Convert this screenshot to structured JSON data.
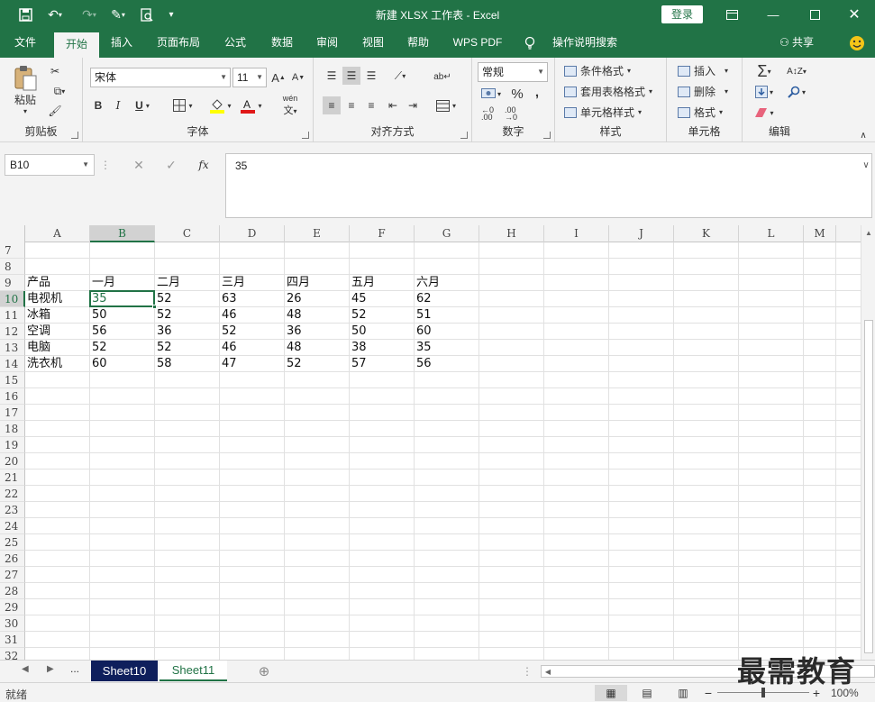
{
  "titlebar": {
    "title": "新建 XLSX 工作表  -  Excel",
    "login": "登录"
  },
  "menu": {
    "tabs": [
      "文件",
      "开始",
      "插入",
      "页面布局",
      "公式",
      "数据",
      "审阅",
      "视图",
      "帮助",
      "WPS PDF",
      "操作说明搜索"
    ],
    "share": "共享"
  },
  "ribbon": {
    "clipboard": {
      "label": "剪贴板",
      "paste": "粘贴"
    },
    "font": {
      "label": "字体",
      "name": "宋体",
      "size": "11",
      "bold": "B",
      "italic": "I",
      "underline": "U",
      "grow": "A",
      "shrink": "A",
      "phonetic": "wén"
    },
    "alignment": {
      "label": "对齐方式"
    },
    "number": {
      "label": "数字",
      "format": "常规",
      "percent": "%",
      "comma": ","
    },
    "styles": {
      "label": "样式",
      "conditional": "条件格式",
      "table": "套用表格格式",
      "cell": "单元格样式"
    },
    "cells": {
      "label": "单元格",
      "insert": "插入",
      "delete": "删除",
      "format": "格式"
    },
    "editing": {
      "label": "编辑",
      "sum": "Σ"
    }
  },
  "formula": {
    "name_box": "B10",
    "value": "35",
    "fx": "fx"
  },
  "grid": {
    "columns": [
      "A",
      "B",
      "C",
      "D",
      "E",
      "F",
      "G",
      "H",
      "I",
      "J",
      "K",
      "L",
      "M"
    ],
    "rows": [
      "7",
      "8",
      "9",
      "10",
      "11",
      "12",
      "13",
      "14",
      "15",
      "16",
      "17",
      "18",
      "19",
      "20",
      "21",
      "22",
      "23",
      "24",
      "25",
      "26",
      "27",
      "28",
      "29",
      "30",
      "31",
      "32"
    ],
    "active_column": "B",
    "active_row": "10",
    "data": [
      [
        "",
        "",
        "",
        "",
        "",
        "",
        ""
      ],
      [
        "",
        "",
        "",
        "",
        "",
        "",
        ""
      ],
      [
        "产品",
        "一月",
        "二月",
        "三月",
        "四月",
        "五月",
        "六月"
      ],
      [
        "电视机",
        "35",
        "52",
        "63",
        "26",
        "45",
        "62"
      ],
      [
        "冰箱",
        "50",
        "52",
        "46",
        "48",
        "52",
        "51"
      ],
      [
        "空调",
        "56",
        "36",
        "52",
        "36",
        "50",
        "60"
      ],
      [
        "电脑",
        "52",
        "52",
        "46",
        "48",
        "38",
        "35"
      ],
      [
        "洗衣机",
        "60",
        "58",
        "47",
        "52",
        "57",
        "56"
      ]
    ]
  },
  "sheets": {
    "tabs": [
      "Sheet10",
      "Sheet11"
    ],
    "more": "..."
  },
  "status": {
    "ready": "就绪",
    "zoom": "100%"
  },
  "watermark": "最需教育",
  "colors": {
    "accent": "#217346",
    "active_tab": "#0f1f5c"
  }
}
